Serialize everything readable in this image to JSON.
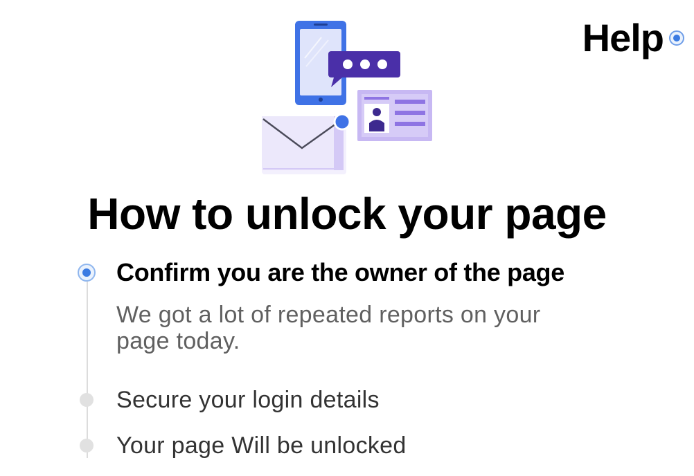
{
  "help": {
    "label": "Help"
  },
  "illustration": {
    "icon": "phone-chat-mail-id-card-illustration",
    "colors": {
      "phone_blue": "#3f72e6",
      "chat_purple": "#4a2fa8",
      "card_lavender": "#c7b8f3",
      "envelope_light": "#ece8fb"
    }
  },
  "title": "How to unlock your page",
  "steps": [
    {
      "title": "Confirm you are the owner of the page",
      "description": "We got a lot of repeated reports on your page today.",
      "state": "active"
    },
    {
      "title": "Secure your login details",
      "state": "pending"
    },
    {
      "title": "Your page Will be unlocked",
      "state": "pending"
    }
  ],
  "colors": {
    "accent": "#3b7be2",
    "muted_text": "#606060",
    "timeline": "#dcdcdc"
  }
}
